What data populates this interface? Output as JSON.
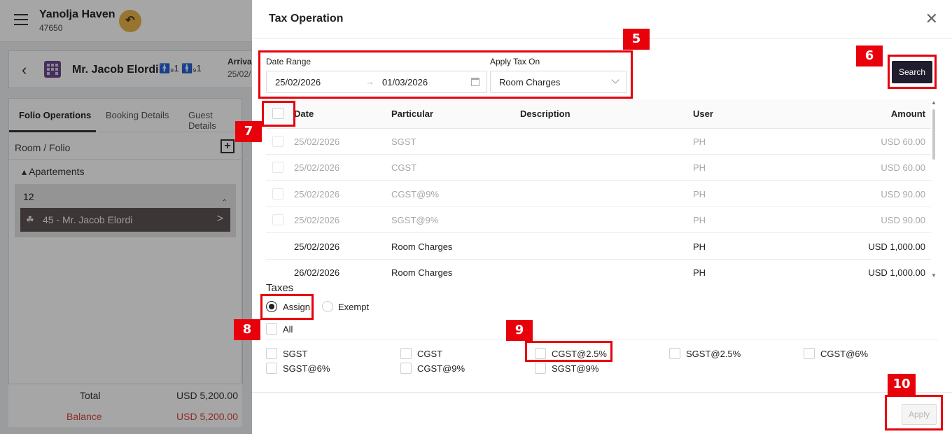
{
  "app": {
    "hotel_name": "Yanolja Haven",
    "hotel_code": "47650",
    "undo_glyph": "↶",
    "back_glyph": "‹",
    "guest_name": "Mr. Jacob Elordi",
    "pax": "🚹₉1 🚹₉1",
    "arrival_label": "Arrival",
    "arrival_value": "25/02/",
    "tabs": [
      "Folio Operations",
      "Booking Details",
      "Guest Details"
    ],
    "room_folio_label": "Room / Folio",
    "add_glyph": "+",
    "group_label": "▴ Apartements",
    "room_number": "12",
    "room_caret": "‸",
    "room_guest": "45 - Mr. Jacob Elordi",
    "room_guest_icon": "☘",
    "room_guest_arrow": ">",
    "total_label": "Total",
    "total_value": "USD 5,200.00",
    "balance_label": "Balance",
    "balance_value": "USD 5,200.00"
  },
  "modal": {
    "title": "Tax Operation",
    "close_glyph": "✕",
    "date_range_label": "Date Range",
    "date_from": "25/02/2026",
    "date_arrow": "→",
    "date_to": "01/03/2026",
    "apply_tax_on_label": "Apply Tax On",
    "apply_tax_on_value": "Room Charges",
    "search_label": "Search",
    "apply_label": "Apply"
  },
  "table": {
    "headers": {
      "date": "Date",
      "particular": "Particular",
      "description": "Description",
      "user": "User",
      "amount": "Amount"
    },
    "rows": [
      {
        "date": "25/02/2026",
        "particular": "SGST",
        "description": "",
        "user": "PH",
        "amount": "USD 60.00"
      },
      {
        "date": "25/02/2026",
        "particular": "CGST",
        "description": "",
        "user": "PH",
        "amount": "USD 60.00"
      },
      {
        "date": "25/02/2026",
        "particular": "CGST@9%",
        "description": "",
        "user": "PH",
        "amount": "USD 90.00"
      },
      {
        "date": "25/02/2026",
        "particular": "SGST@9%",
        "description": "",
        "user": "PH",
        "amount": "USD 90.00"
      },
      {
        "date": "25/02/2026",
        "particular": "Room Charges",
        "description": "",
        "user": "PH",
        "amount": "USD 1,000.00"
      },
      {
        "date": "26/02/2026",
        "particular": "Room Charges",
        "description": "",
        "user": "PH",
        "amount": "USD 1,000.00"
      }
    ],
    "scroll_up": "▲",
    "scroll_down": "▼"
  },
  "taxes": {
    "title": "Taxes",
    "assign_label": "Assign",
    "exempt_label": "Exempt",
    "selected": "Assign",
    "all_label": "All",
    "items": [
      "SGST",
      "CGST",
      "CGST@2.5%",
      "SGST@2.5%",
      "CGST@6%",
      "SGST@6%",
      "CGST@9%",
      "SGST@9%"
    ]
  },
  "annotations": [
    "5",
    "6",
    "7",
    "8",
    "9",
    "10"
  ],
  "colors": {
    "highlight": "#e8000b",
    "search_button": "#1f1d2e",
    "balance": "#d9423b"
  }
}
